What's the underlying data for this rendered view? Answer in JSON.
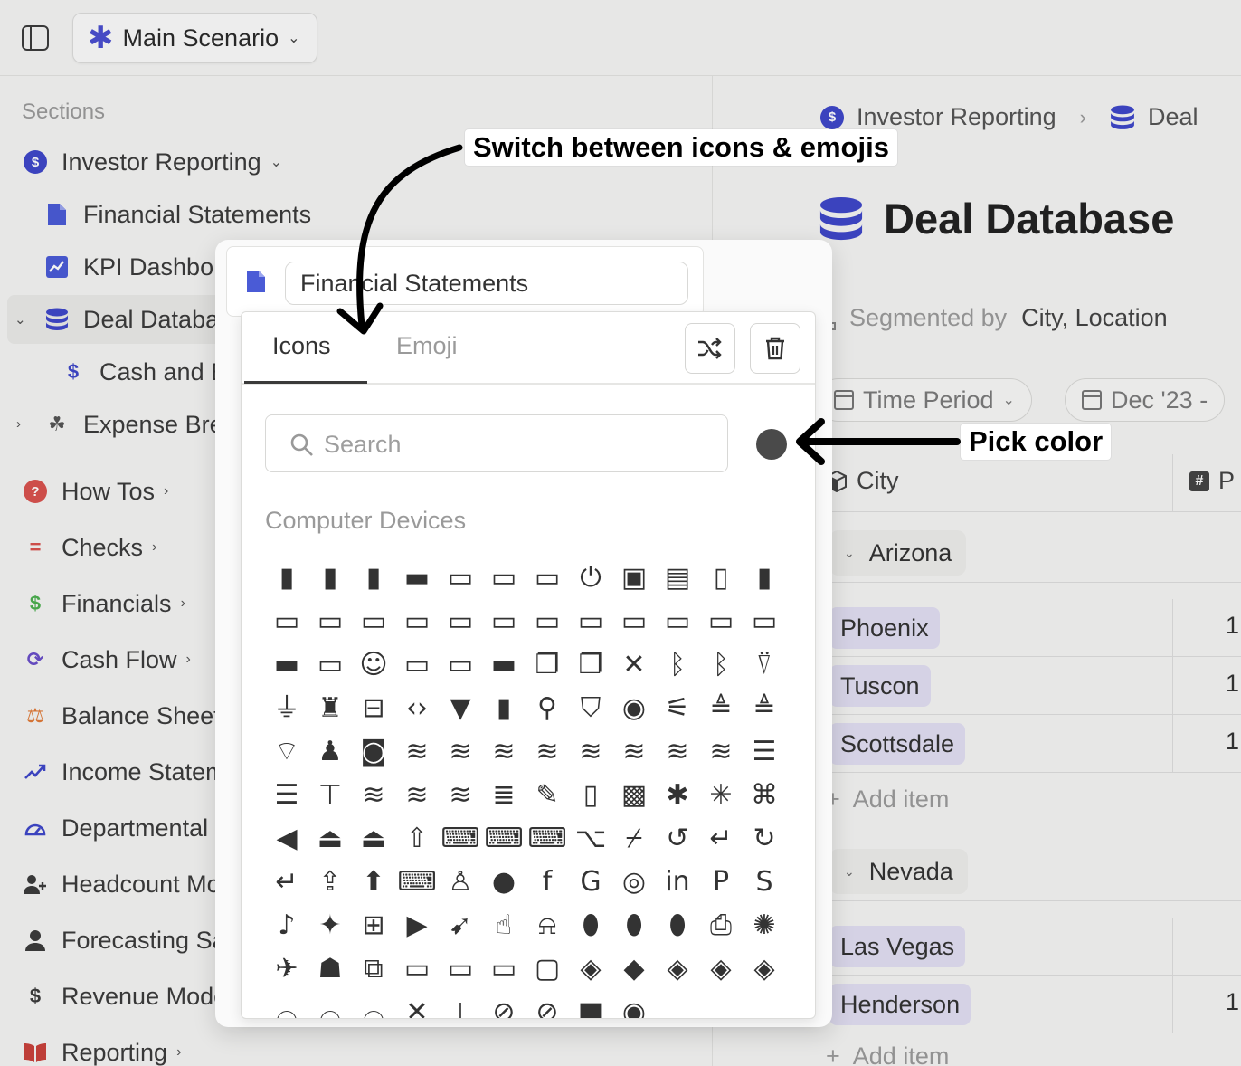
{
  "topbar": {
    "scenario_label": "Main Scenario"
  },
  "sidebar": {
    "heading": "Sections",
    "items": [
      {
        "label": "Investor Reporting"
      },
      {
        "label": "Financial Statements"
      },
      {
        "label": "KPI Dashbo"
      },
      {
        "label": "Deal Databas"
      },
      {
        "label": "Cash and B"
      },
      {
        "label": "Expense Brea"
      },
      {
        "label": "How Tos"
      },
      {
        "label": "Checks"
      },
      {
        "label": "Financials"
      },
      {
        "label": "Cash Flow"
      },
      {
        "label": "Balance Sheet"
      },
      {
        "label": "Income Statem"
      },
      {
        "label": "Departmental I"
      },
      {
        "label": "Headcount Mo"
      },
      {
        "label": "Forecasting Sa"
      },
      {
        "label": "Revenue Mode"
      },
      {
        "label": "Reporting"
      }
    ]
  },
  "main": {
    "breadcrumb": {
      "first": "Investor Reporting",
      "second": "Deal"
    },
    "title": "Deal Database",
    "segmented_key": "Segmented by",
    "segmented_value": "City, Location",
    "chips": {
      "time_period": "Time Period",
      "date": "Dec '23 -"
    },
    "columns": {
      "city": "City",
      "second": "P"
    },
    "groups": [
      {
        "name": "Arizona",
        "rows": [
          {
            "city": "Phoenix",
            "value": "1"
          },
          {
            "city": "Tuscon",
            "value": "1"
          },
          {
            "city": "Scottsdale",
            "value": "1"
          }
        ]
      },
      {
        "name": "Nevada",
        "rows": [
          {
            "city": "Las Vegas",
            "value": ""
          },
          {
            "city": "Henderson",
            "value": "1"
          }
        ]
      }
    ],
    "add_item": "Add item"
  },
  "popover": {
    "name_value": "Financial Statements",
    "tabs": {
      "icons": "Icons",
      "emoji": "Emoji"
    },
    "search_placeholder": "Search",
    "selected_color": "#4a4a4a",
    "category": "Computer Devices",
    "icons": [
      "battery-exclamation",
      "battery-bolt",
      "battery-slash",
      "battery-full",
      "battery-half",
      "battery-three-quarters",
      "battery-quarter",
      "power-bolt",
      "microchip",
      "memory",
      "sd-card",
      "sim-card",
      "desktop-plus",
      "desktop-clock",
      "desktop-check",
      "desktop-xmark",
      "desktop-heart",
      "desktop-star",
      "desktop-question",
      "desktop-lock",
      "desktop-cast",
      "desktop-location",
      "desktop-exclamation",
      "desktop",
      "laptop",
      "desktop-code",
      "desktop-smile",
      "desktop-search",
      "desktop-lock-alt",
      "laptop-lightning",
      "windows-stack",
      "windows-overlap",
      "bluetooth-slash",
      "bluetooth-signal",
      "bluetooth",
      "signal-tower",
      "plug",
      "joystick-alt",
      "router",
      "code-pair",
      "usb-plug",
      "usb-drive",
      "usb-symbol",
      "shield-wifi",
      "broadcast",
      "wifi-slash",
      "signal-stream",
      "signal-stream-alt",
      "wifi",
      "joystick",
      "gamepad",
      "database-plus",
      "database-warning",
      "database-slash",
      "database-check",
      "database-lock",
      "database-sync",
      "database-xmark",
      "database-search",
      "server",
      "server-rack",
      "server-network",
      "database-gear",
      "database-shield",
      "database-minus",
      "database",
      "pen-to-square",
      "tablet",
      "alt-key",
      "asterisk",
      "asterisk-bold",
      "command-key",
      "backspace-key",
      "eject-fill",
      "eject",
      "shift-key",
      "keyboard-down",
      "keyboard-alt",
      "keyboard-tilt",
      "option-key",
      "toggle-route",
      "rotate-back",
      "return-key",
      "redo-arrow",
      "enter-key",
      "caps-lock",
      "arrow-up-bold",
      "keyboard",
      "android",
      "apple",
      "facebook",
      "google",
      "instagram",
      "linkedin",
      "paypal",
      "skype",
      "tiktok",
      "twitter",
      "windows",
      "youtube",
      "pointer-click",
      "mouse-hand",
      "mouse-signal",
      "mouse",
      "mouse-left",
      "mouse-right",
      "printer",
      "bug",
      "drone",
      "robot",
      "devices",
      "monitor",
      "monitor-x",
      "monitor-stand",
      "television",
      "diamond-rotate",
      "diamond-left",
      "diamond-arrows",
      "diamond-nav",
      "diamond-code",
      "headset-up",
      "headset-mid",
      "headset-low",
      "microphone-slash",
      "microphone",
      "camera-slash",
      "video-slash",
      "video-camera",
      "webcam"
    ]
  },
  "annotations": {
    "switch_label": "Switch between icons & emojis",
    "color_label": "Pick color"
  }
}
